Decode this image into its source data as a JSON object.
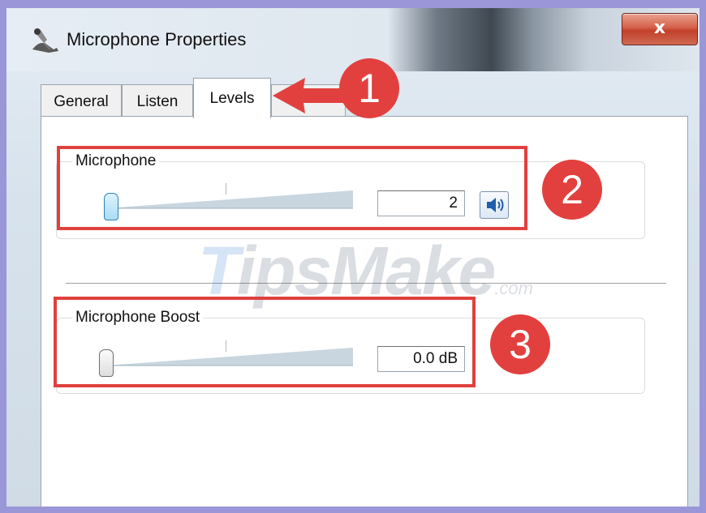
{
  "window": {
    "title": "Microphone Properties",
    "close_symbol": "x"
  },
  "tabs": [
    {
      "label": "General",
      "active": false
    },
    {
      "label": "Listen",
      "active": false
    },
    {
      "label": "Levels",
      "active": true
    }
  ],
  "microphone": {
    "label": "Microphone",
    "value": "2",
    "level": 0.02,
    "mute_button_icon": "speaker-volume-icon"
  },
  "microphone_boost": {
    "label": "Microphone Boost",
    "value": "0.0 dB",
    "level": 0
  },
  "annotations": {
    "badge_1": "1",
    "badge_2": "2",
    "badge_3": "3",
    "highlight_color": "#e0403e"
  },
  "watermark": {
    "brand_first": "T",
    "brand_rest": "ipsMake",
    "suffix": ".com"
  },
  "colors": {
    "frame": "#9a96d8",
    "accent_blue": "#2f7fb6",
    "badge": "#e2403e"
  }
}
